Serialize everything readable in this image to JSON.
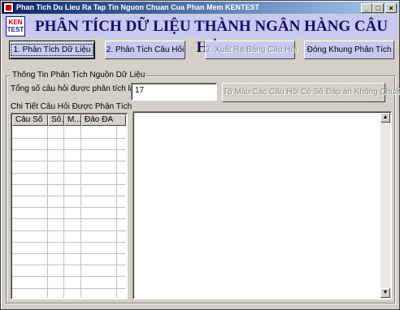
{
  "window": {
    "title": "Phan Tich Du Lieu Ra Tap Tin Nguon Chuan Cua Phan Mem KENTEST",
    "controls": {
      "minimize": "_",
      "maximize": "□",
      "close": "×"
    }
  },
  "header": {
    "logo_top": "KEN",
    "logo_bottom": "TEST",
    "title": "PHÂN TÍCH DỮ LIỆU THÀNH NGÂN HÀNG CÂU HỎI"
  },
  "menu": {
    "analyze_data": "1. Phân Tích Dữ Liệu",
    "analyze_questions": "2. Phân Tích Câu Hỏi",
    "export_table": "3. Xuất Ra Bảng Câu Hỏi",
    "close_frame": "Đóng Khung Phân Tích"
  },
  "info_group": {
    "label": "Thông Tin Phân Tích Nguồn Dữ Liệu",
    "total_label": "Tổng số câu hỏi được phân tích là :",
    "total_value": "17",
    "highlight_button": "Tô Màu Các Câu Hỏi Có Số Đáp án Không Chuẩn",
    "details_label": "Chi Tiết Câu Hỏi Được Phân Tích"
  },
  "grid": {
    "columns": [
      "Câu Số",
      "Số...",
      "M...",
      "Đảo ĐA"
    ]
  },
  "scrollbar": {
    "up": "▲",
    "down": "▼"
  }
}
